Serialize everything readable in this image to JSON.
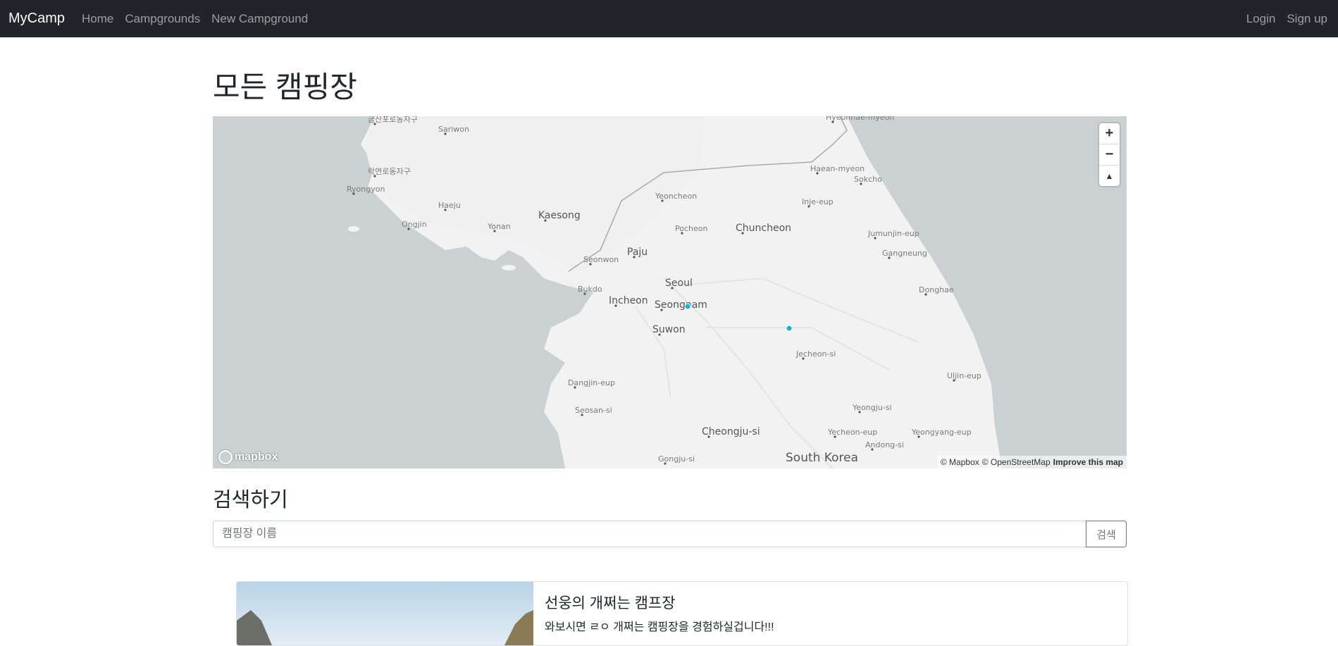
{
  "navbar": {
    "brand": "MyCamp",
    "links": [
      "Home",
      "Campgrounds",
      "New Campground"
    ],
    "right_links": [
      "Login",
      "Sign up"
    ]
  },
  "page": {
    "title": "모든 캠핑장"
  },
  "map": {
    "country_label": "South Korea",
    "place_labels": [
      "금산포로동자구",
      "Sariwon",
      "락연로동자구",
      "Ryongyon",
      "Haeju",
      "Ongjin",
      "Yonan",
      "Kaesong",
      "Yeoncheon",
      "Pocheon",
      "Chuncheon",
      "Paju",
      "Seonwon",
      "Seoul",
      "Bukdo",
      "Incheon",
      "Seongnam",
      "Suwon",
      "Dangjin-eup",
      "Seosan-si",
      "Cheongju-si",
      "Gongju-si",
      "Hyeonnae-myeon",
      "Haean-myeon",
      "Sokcho",
      "Inje-eup",
      "Jumunjin-eup",
      "Gangneung",
      "Donghae",
      "Jecheon-si",
      "Uljin-eup",
      "Yeongju-si",
      "Yecheon-eup",
      "Yeongyang-eup",
      "Andong-si"
    ],
    "zoom_in": "+",
    "zoom_out": "−",
    "compass": "▲",
    "logo": "mapbox",
    "attribution": [
      "© Mapbox",
      "© OpenStreetMap"
    ],
    "improve": "Improve this map",
    "colors": {
      "water": "#c9d1d3",
      "land": "#f2f2f2",
      "marker": "#1ab2cf"
    }
  },
  "search": {
    "title": "검색하기",
    "placeholder": "캠핑장 이름",
    "button": "검색"
  },
  "campgrounds": [
    {
      "title": "선웅의 개쩌는 캠프장",
      "description": "와보시면 ㄹㅇ 개쩌는 캠핑장을 경험하실겁니다!!!"
    }
  ]
}
